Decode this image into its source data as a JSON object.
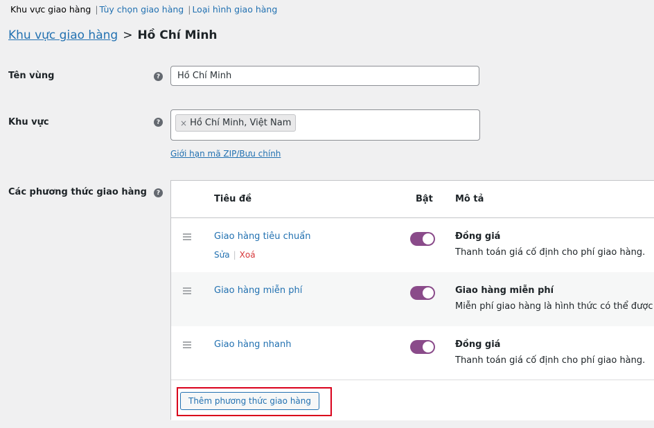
{
  "subnav": {
    "current": "Khu vực giao hàng",
    "items": [
      {
        "label": "Tùy chọn giao hàng"
      },
      {
        "label": "Loại hình giao hàng"
      }
    ],
    "separator": "|"
  },
  "breadcrumb": {
    "parent": "Khu vực giao hàng",
    "separator": ">",
    "current": "Hồ Chí Minh"
  },
  "form": {
    "zone_name": {
      "label": "Tên vùng",
      "value": "Hồ Chí Minh"
    },
    "region": {
      "label": "Khu vực",
      "tokens": [
        {
          "label": "Hồ Chí Minh, Việt Nam",
          "remove_glyph": "×"
        }
      ],
      "zip_link": "Giới hạn mã ZIP/Bưu chính"
    },
    "methods": {
      "label": "Các phương thức giao hàng",
      "columns": {
        "title": "Tiêu đề",
        "enabled": "Bật",
        "description": "Mô tả"
      },
      "rows": [
        {
          "title": "Giao hàng tiêu chuẩn",
          "edit": "Sửa",
          "action_divider": "|",
          "delete": "Xoá",
          "enabled": true,
          "desc_title": "Đồng giá",
          "desc_text": "Thanh toán giá cố định cho phí giao hàng."
        },
        {
          "title": "Giao hàng miễn phí",
          "enabled": true,
          "desc_title": "Giao hàng miễn phí",
          "desc_text": "Miễn phí giao hàng là hình thức có thể được ki"
        },
        {
          "title": "Giao hàng nhanh",
          "enabled": true,
          "desc_title": "Đồng giá",
          "desc_text": "Thanh toán giá cố định cho phí giao hàng."
        }
      ],
      "add_button": "Thêm phương thức giao hàng"
    }
  },
  "icons": {
    "help": "?",
    "help_icon_name": "question-circle-icon",
    "drag_icon_name": "drag-handle-icon"
  },
  "colors": {
    "accent": "#2271b1",
    "toggle_on": "#8a4b8a",
    "delete": "#d63638",
    "highlight": "#d9001b",
    "background": "#f0f0f1"
  }
}
